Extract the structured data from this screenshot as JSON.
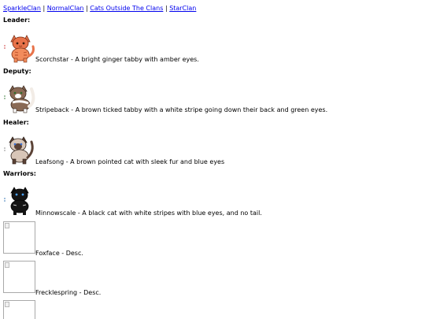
{
  "nav": {
    "links": [
      "SparkleClan",
      "NormalClan",
      "Cats Outside The Clans",
      "StarClan"
    ],
    "separator": "|"
  },
  "sections": {
    "leader": "Leader:",
    "deputy": "Deputy:",
    "healer": "Healer:",
    "warriors": "Warriors:"
  },
  "cats": {
    "scorchstar": "Scorchstar - A bright ginger tabby with amber eyes.",
    "stripeback": "Stripeback - A brown ticked tabby with a white stripe going down their back and green eyes.",
    "leafsong": "Leafsong - A brown pointed cat with sleek fur and blue eyes",
    "minnowscale": "Minnowscale - A black cat with white stripes with blue eyes, and no tail.",
    "foxface": "Foxface - Desc.",
    "frecklespring": "Frecklespring - Desc."
  },
  "icons": {
    "scorchstar": "ginger-tabby-cat-sprite",
    "stripeback": "brown-tabby-cat-sprite",
    "leafsong": "siamese-cat-sprite",
    "minnowscale": "black-cat-sprite",
    "broken": "broken-image-icon"
  },
  "colors": {
    "link": "#0000ee",
    "ginger": "#e8734a",
    "brown": "#8a6a55",
    "siamese_body": "#d8c6b8",
    "siamese_points": "#5b4236",
    "black": "#141414"
  }
}
